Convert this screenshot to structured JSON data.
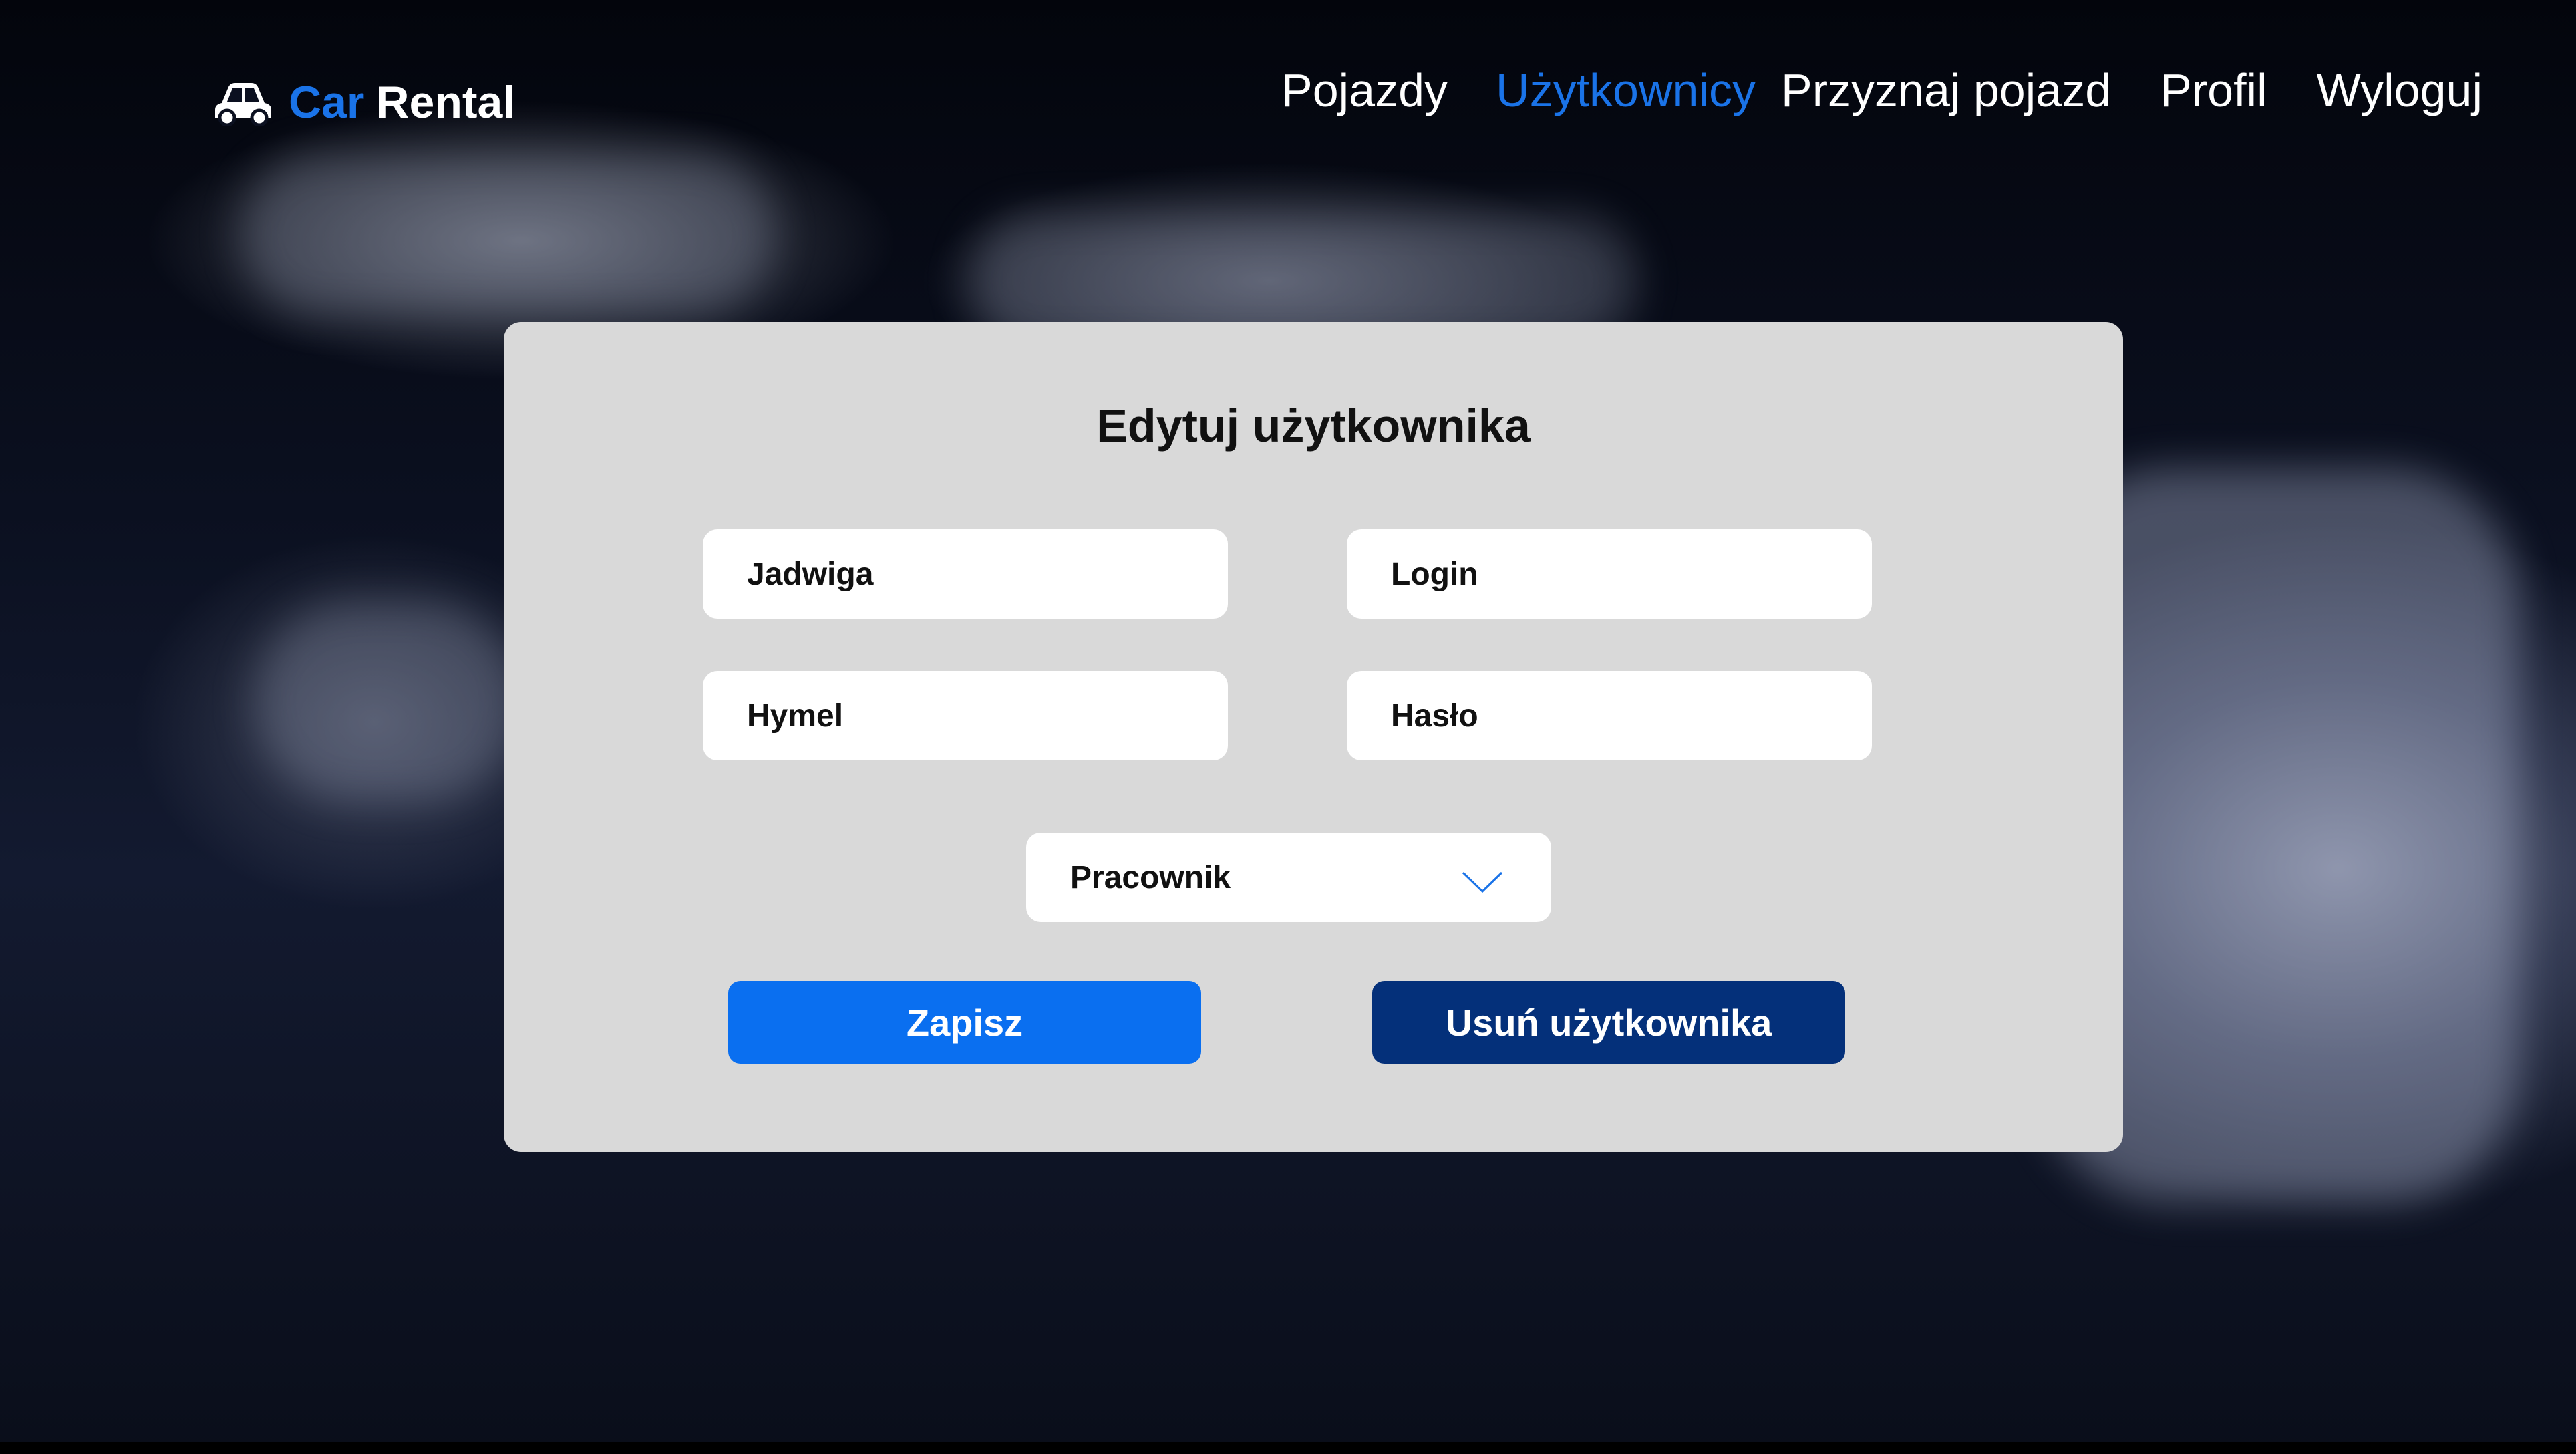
{
  "app": {
    "brand_part1": "Car",
    "brand_part2": "Rental",
    "logo_icon": "car-icon"
  },
  "nav": {
    "items": [
      {
        "label": "Pojazdy",
        "active": false
      },
      {
        "label": "Użytkownicy",
        "active": true
      },
      {
        "label": "Przyznaj pojazd",
        "active": false
      },
      {
        "label": "Profil",
        "active": false
      },
      {
        "label": "Wyloguj",
        "active": false
      }
    ]
  },
  "form": {
    "title": "Edytuj użytkownika",
    "first_name": "Jadwiga",
    "last_name": "Hymel",
    "login_placeholder": "Login",
    "password_placeholder": "Hasło",
    "role_selected": "Pracownik",
    "role_dropdown_icon": "chevron-down-icon",
    "save_label": "Zapisz",
    "delete_label": "Usuń użytkownika"
  },
  "colors": {
    "accent": "#1a73e8",
    "save_button": "#0a6ff0",
    "delete_button": "#04307a",
    "card_background": "#d9d9d9"
  }
}
